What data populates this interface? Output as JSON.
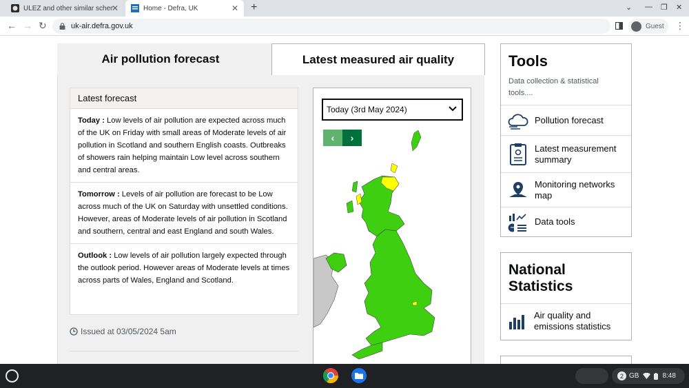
{
  "browser": {
    "tabs": [
      {
        "title": "ULEZ and other similar schemes",
        "active": false
      },
      {
        "title": "Home - Defra, UK",
        "active": true
      }
    ],
    "url": "uk-air.defra.gov.uk",
    "profile_label": "Guest"
  },
  "page": {
    "tabs": {
      "forecast_label": "Air pollution forecast",
      "measured_label": "Latest measured air quality"
    },
    "forecast": {
      "heading": "Latest forecast",
      "items": [
        {
          "label": "Today :",
          "text": " Low levels of air pollution are expected across much of the UK on Friday with small areas of Moderate levels of air pollution in Scotland and southern English coasts. Outbreaks of showers rain helping maintain Low level across southern and central areas."
        },
        {
          "label": "Tomorrow :",
          "text": " Levels of air pollution are forecast to be Low across much of the UK on Saturday with unsettled conditions. However, areas of Moderate levels of air pollution in Scotland and southern, central and east England and south Wales."
        },
        {
          "label": "Outlook :",
          "text": " Low levels of air pollution largely expected through the outlook period. However areas of Moderate levels at times across parts of Wales, England and Scotland."
        }
      ],
      "issued": "Issued at 03/05/2024 5am"
    },
    "map": {
      "selected_day": "Today (3rd May 2024)",
      "prev_label": "‹",
      "next_label": "›",
      "colors": {
        "low": "#3ecf10",
        "moderate": "#ffff00",
        "other_land": "#c8c8c8"
      }
    },
    "sidebar": {
      "tools": {
        "title": "Tools",
        "description": "Data collection & statistical tools....",
        "items": [
          {
            "label": "Pollution forecast",
            "icon": "cloud-icon"
          },
          {
            "label": "Latest measurement summary",
            "icon": "clipboard-icon"
          },
          {
            "label": "Monitoring networks map",
            "icon": "map-pin-icon"
          },
          {
            "label": "Data tools",
            "icon": "chart-tools-icon"
          }
        ]
      },
      "national_statistics": {
        "title": "National Statistics",
        "item_label": "Air quality and emissions statistics",
        "icon": "bar-chart-icon"
      }
    }
  },
  "shelf": {
    "notification_count": "2",
    "region": "GB",
    "time": "8:48"
  }
}
